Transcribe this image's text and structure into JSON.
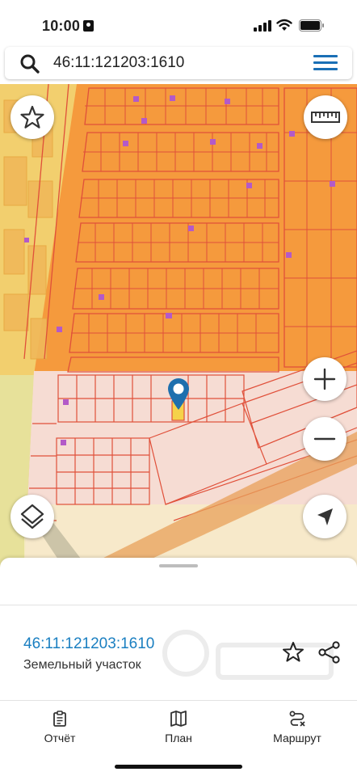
{
  "status_bar": {
    "time": "10:00"
  },
  "search": {
    "query": "46:11:121203:1610"
  },
  "map": {
    "icons": [
      "favorite-star-icon",
      "ruler-icon",
      "zoom-in-icon",
      "zoom-out-icon",
      "layers-icon",
      "locate-arrow-icon",
      "location-pin-icon"
    ],
    "colors": {
      "zone_orange": "#f59a3d",
      "parcel_line": "#e0503a",
      "zone_yellow": "#f2d474",
      "zone_pink": "#f6dcd3",
      "selected_parcel": "#f5d24a"
    }
  },
  "sheet": {
    "cadastral_number": "46:11:121203:1610",
    "object_type": "Земельный участок"
  },
  "tabs": [
    {
      "label": "Отчёт",
      "icon": "clipboard-icon"
    },
    {
      "label": "План",
      "icon": "map-icon"
    },
    {
      "label": "Маршрут",
      "icon": "route-icon"
    }
  ],
  "accent_color": "#1a7fc1"
}
